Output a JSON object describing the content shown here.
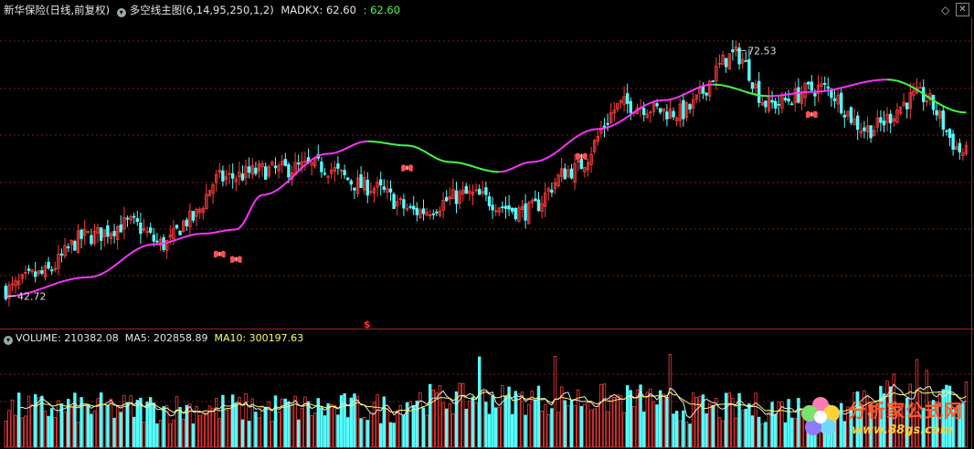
{
  "header": {
    "stock": "新华保险(日线,前复权)",
    "indicator": "多空线主图(6,14,95,250,1,2)",
    "madkx_label": "MADKX: 62.60",
    "madkx_extra": ": 62.60"
  },
  "volume_header": {
    "volume": "VOLUME: 210382.08",
    "ma5": "MA5: 202858.89",
    "ma10": "MA10: 300197.63"
  },
  "markers": {
    "high_label": "72.53",
    "low_label": "42.72",
    "s_mark": "$"
  },
  "watermark": {
    "title": "分析家公式网",
    "url": "www.88gs.com"
  },
  "colors": {
    "up": "#ff3b3b",
    "down": "#54ffff",
    "line_up": "#ff33ff",
    "line_down": "#44ff44",
    "grid": "#7a1a1a",
    "ma10": "#ffff66",
    "butterfly": "#ff5050"
  },
  "chart_data": [
    {
      "type": "candlestick",
      "title": "新华保险(日线,前复权)",
      "price_range": [
        41,
        76
      ],
      "extremes": {
        "high": 72.53,
        "low": 42.72
      },
      "price_path": [
        [
          0,
          43.5
        ],
        [
          10,
          45.3
        ],
        [
          25,
          50
        ],
        [
          38,
          51.5
        ],
        [
          48,
          49
        ],
        [
          56,
          52
        ],
        [
          65,
          57
        ],
        [
          80,
          58
        ],
        [
          95,
          58.5
        ],
        [
          110,
          56
        ],
        [
          125,
          53
        ],
        [
          140,
          55
        ],
        [
          158,
          53
        ],
        [
          172,
          58
        ],
        [
          188,
          66
        ],
        [
          205,
          65
        ],
        [
          222,
          72
        ],
        [
          232,
          66
        ],
        [
          248,
          68
        ],
        [
          262,
          63
        ],
        [
          278,
          67
        ],
        [
          292,
          60
        ]
      ],
      "madkx_path": [
        [
          0,
          42.7
        ],
        [
          25,
          45
        ],
        [
          45,
          49
        ],
        [
          60,
          50.3
        ],
        [
          70,
          50.8
        ],
        [
          78,
          55
        ],
        [
          98,
          60
        ],
        [
          110,
          61.5
        ],
        [
          122,
          61
        ],
        [
          135,
          59
        ],
        [
          150,
          57.8
        ],
        [
          160,
          59
        ],
        [
          180,
          63
        ],
        [
          200,
          66.5
        ],
        [
          215,
          68.4
        ],
        [
          232,
          67
        ],
        [
          245,
          67.5
        ],
        [
          268,
          69
        ],
        [
          292,
          65
        ]
      ],
      "butterfly_bars": [
        65,
        70,
        122,
        175,
        245
      ],
      "s_bar": 110
    },
    {
      "type": "bar",
      "title": "VOLUME",
      "series": [
        {
          "name": "VOLUME",
          "last": 210382.08
        },
        {
          "name": "MA5",
          "last": 202858.89
        },
        {
          "name": "MA10",
          "last": 300197.63
        }
      ],
      "spike_bars": [
        144,
        167,
        202,
        270,
        277,
        280
      ]
    }
  ]
}
